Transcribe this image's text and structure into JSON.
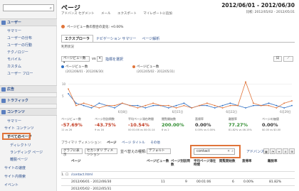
{
  "sidebar": {
    "search_placeholder": "",
    "sections": [
      {
        "label": "ユーザー",
        "items": [
          "サマリー",
          "ユーザーの分布",
          "ユーザーの行動",
          "テクノロジー",
          "モバイル",
          "カスタム",
          "ユーザー フロー"
        ]
      },
      {
        "label": "広告",
        "items": []
      },
      {
        "label": "トラフィック",
        "items": []
      },
      {
        "label": "コンテンツ",
        "items": [
          "サマリー",
          "サイト コンテンツ",
          "すべてのページ",
          "ディレクトリ",
          "ランディング ページ",
          "離脱ページ",
          "サイトの速度",
          "サイト内検索",
          "イベント"
        ]
      }
    ]
  },
  "header": {
    "title": "ページ",
    "date_range": "2012/06/01 - 2012/06/30",
    "compare_range": "比較: 2012/05/02 - 2012/05/31",
    "toolbar": [
      "アドバンス セグメント",
      "メール",
      "エクスポート",
      "マイレポートに追加"
    ]
  },
  "segment": {
    "label": "ページビュー数の割合の変化: +0.00%"
  },
  "tabs": [
    "エクスプローラ",
    "ナビゲーション サマリー",
    "ページ解析"
  ],
  "sublabel": "利用状況",
  "controls": {
    "metric_select": "ページビュー数",
    "vs_label": "vs",
    "metric_select2": "指標を選択"
  },
  "legend": [
    {
      "label": "ページビュー数 (2012/06/01 - 2012/06/30)",
      "color": "#2e6fc4"
    },
    {
      "label": "ページビュー数 (2012/05/02 - 2012/05/31)",
      "color": "#e0743a"
    }
  ],
  "chart_data": {
    "type": "line",
    "x_ticks": [
      "6月8日",
      "6月15日",
      "6月22日",
      "6月29日"
    ],
    "y_ticks": [
      "10",
      "5"
    ],
    "series": [
      {
        "name": "ページビュー数 (2012/06/01 - 2012/06/30)",
        "values": [
          6,
          2,
          1,
          0,
          2,
          1,
          0,
          2,
          1,
          1,
          0,
          1,
          1,
          0,
          1,
          2,
          0,
          1,
          1,
          0,
          1,
          2,
          1,
          0,
          1,
          1,
          2,
          1,
          0,
          1
        ]
      },
      {
        "name": "ページビュー数 (2012/05/02 - 2012/05/31)",
        "values": [
          8,
          1,
          2,
          1,
          0,
          1,
          1,
          2,
          1,
          0,
          1,
          2,
          1,
          1,
          0,
          1,
          0,
          1,
          2,
          1,
          0,
          1,
          1,
          11,
          2,
          1,
          1,
          0,
          2,
          3
        ]
      }
    ]
  },
  "metrics": [
    {
      "label": "ページビュー数",
      "value": "-57.69%",
      "sub": "11 vs 26",
      "tone": "neg"
    },
    {
      "label": "ページ別訪問数",
      "value": "-43.75%",
      "sub": "9 vs 16",
      "tone": "neg"
    },
    {
      "label": "平均ページ滞在時間",
      "value": "-10.54%",
      "sub": "00:01:06 vs 00:01:14",
      "tone": "neg"
    },
    {
      "label": "閲覧開始数",
      "value": "200.00%",
      "sub": "6 vs 2",
      "tone": "pos"
    },
    {
      "label": "直帰率",
      "value": "0.00%",
      "sub": "0.00% vs 0.00%",
      "tone": "neutral"
    },
    {
      "label": "離脱率",
      "value": "77.27%",
      "sub": "81.82% vs 46.15%",
      "tone": "pos"
    },
    {
      "label": "ページの価値",
      "value": "0.00%",
      "sub": "$0.00 vs $0.00",
      "tone": "neutral"
    }
  ],
  "dimension_row": [
    "プライマリ ディメンション:",
    "ページ",
    "ページ タイトル",
    "その他"
  ],
  "filter_row": {
    "chart_select": "グラフに表示",
    "secondary_dim": "セカンダリ ディメンション",
    "sort_type": "並べ替えの種類:",
    "sort_value": "デフォルト",
    "filter_value": "contact",
    "advanced": "アドバンス"
  },
  "table": {
    "headers": [
      "ページ",
      "ページビュー数",
      "ページ別訪問数",
      "平均ページ滞在時間",
      "閲覧開始数",
      "直帰率",
      "離脱率"
    ],
    "rows": [
      {
        "index": "1.",
        "page": "/contact.html",
        "cells": [
          "",
          "",
          "",
          "",
          "",
          ""
        ]
      },
      {
        "index": "",
        "page": "2012/06/01 - 2012/06/30",
        "cells": [
          "11",
          "9",
          "00:01:06",
          "6",
          "0.00%",
          "81.82%"
        ]
      },
      {
        "index": "",
        "page": "2012/05/02 - 2012/05/31",
        "cells": [
          "",
          "",
          "",
          "",
          "",
          ""
        ]
      }
    ]
  }
}
